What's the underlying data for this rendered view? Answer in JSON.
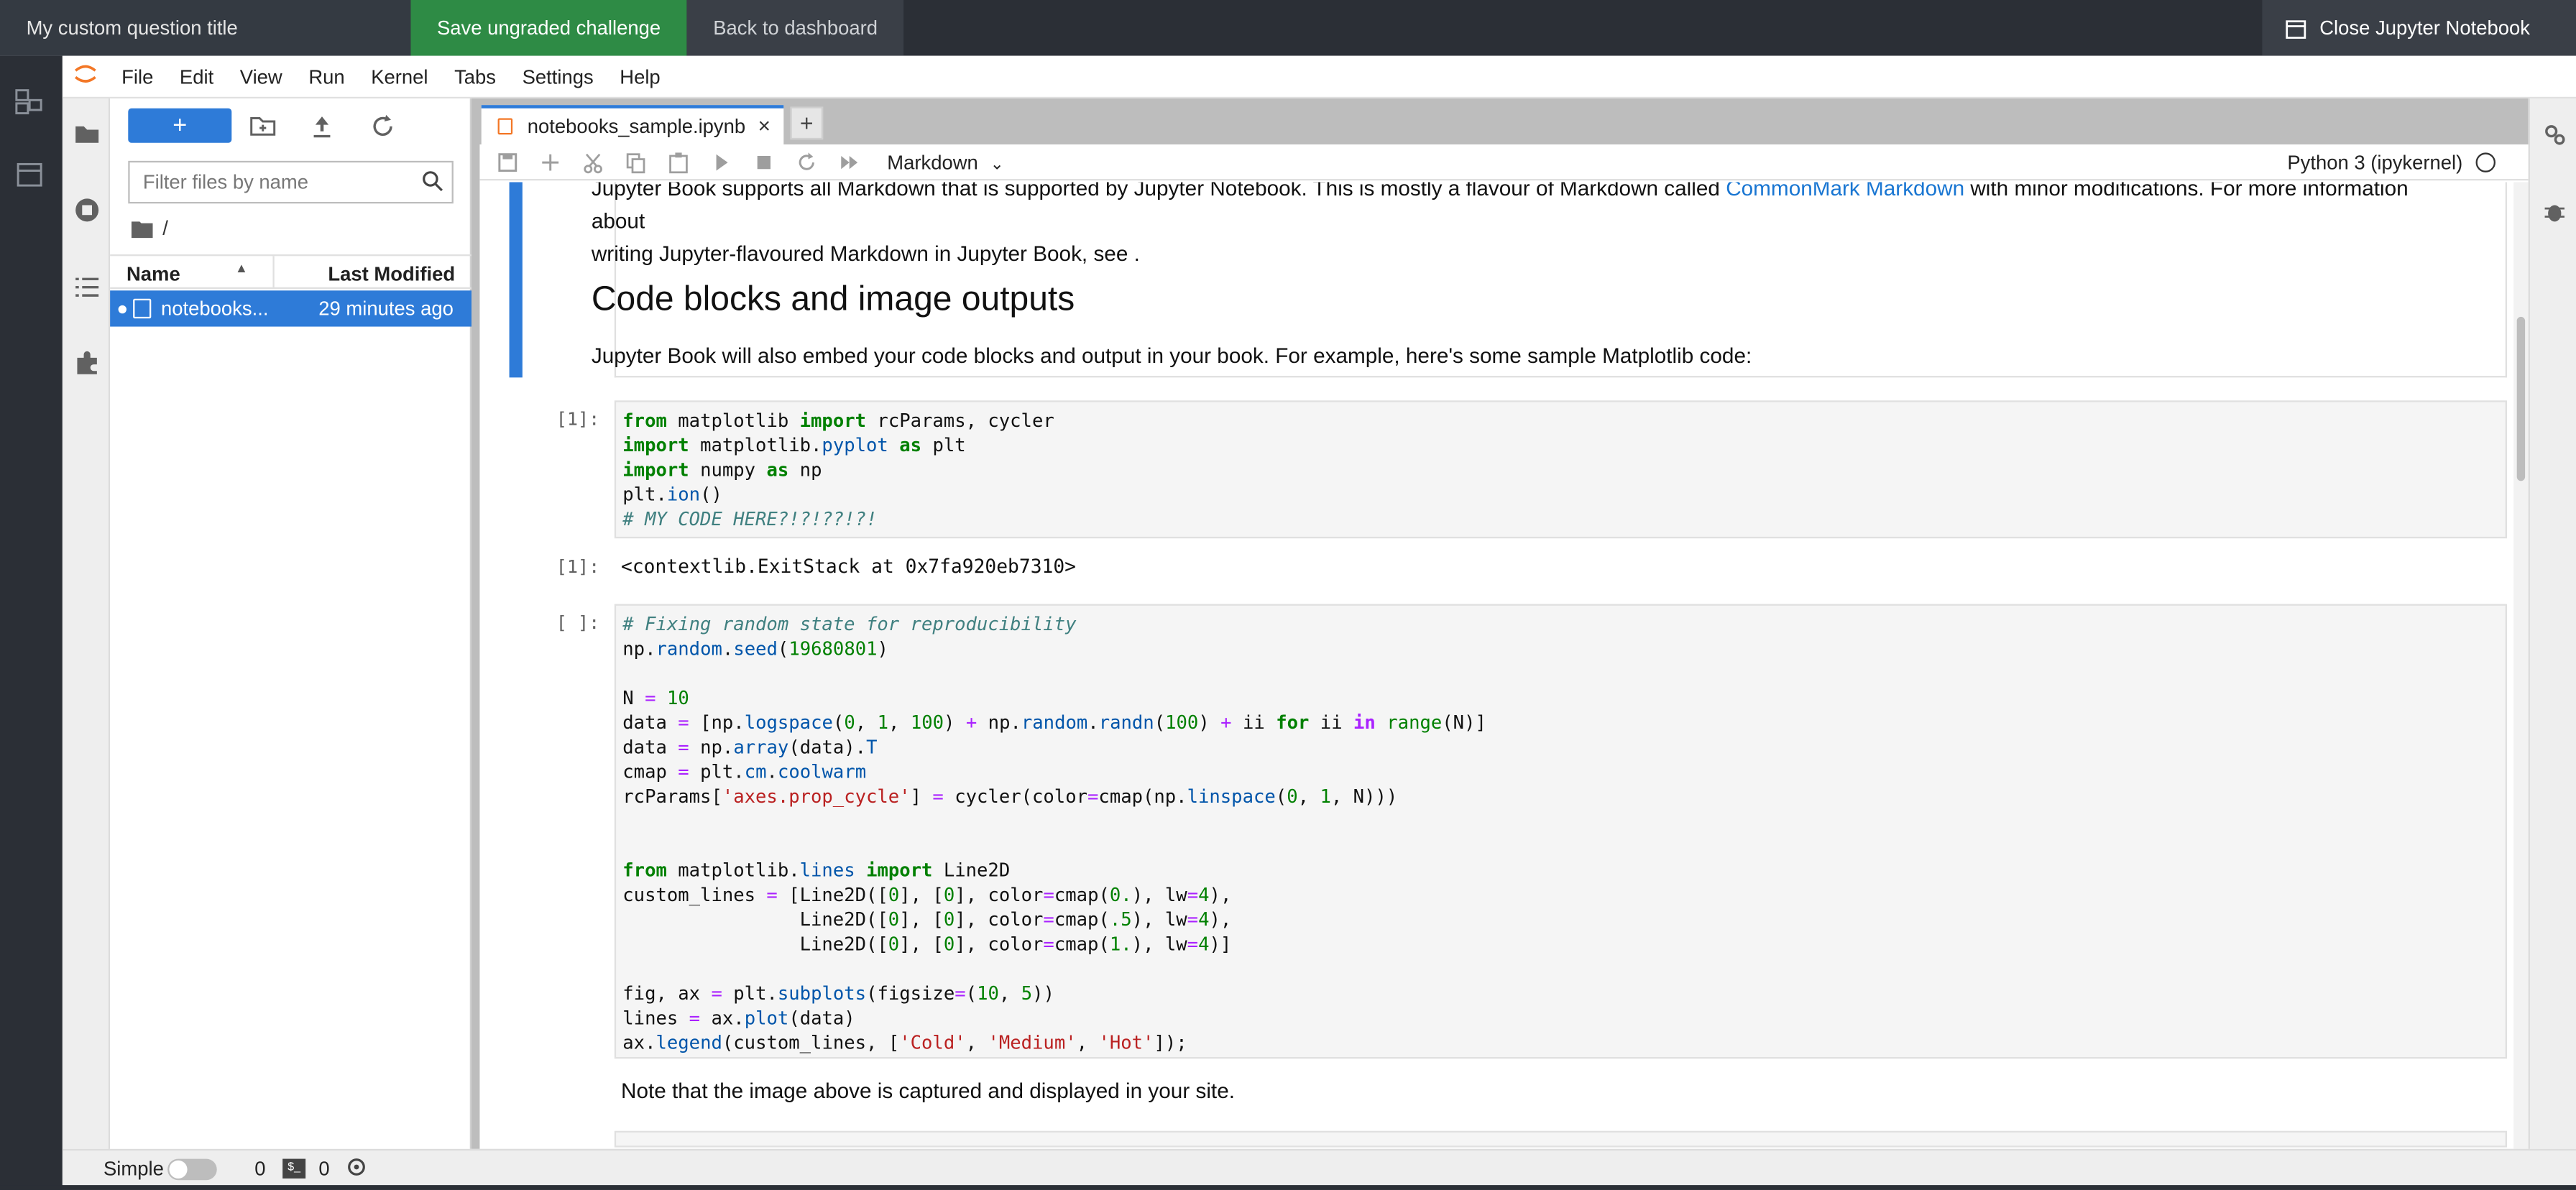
{
  "topbar": {
    "question_title": "My custom question title",
    "save_label": "Save ungraded challenge",
    "back_label": "Back to dashboard",
    "close_label": "Close Jupyter Notebook"
  },
  "menu": [
    "File",
    "Edit",
    "View",
    "Run",
    "Kernel",
    "Tabs",
    "Settings",
    "Help"
  ],
  "filebrowser": {
    "new_label": "+",
    "filter_placeholder": "Filter files by name",
    "breadcrumb": "/",
    "col_name": "Name",
    "col_modified": "Last Modified",
    "files": [
      {
        "name": "notebooks...",
        "modified": "29 minutes ago"
      }
    ]
  },
  "tab": {
    "title": "notebooks_sample.ipynb",
    "close": "×",
    "add": "+"
  },
  "toolbar": {
    "cell_type": "Markdown",
    "kernel": "Python 3 (ipykernel)"
  },
  "notebook": {
    "md_line1_a": "Jupyter Book supports all Markdown that is supported by Jupyter Notebook. This is mostly a flavour of Markdown called ",
    "md_link": "CommonMark Markdown",
    "md_line1_b": " with minor modifications. For more information about",
    "md_line2": "writing Jupyter-flavoured Markdown in Jupyter Book, see .",
    "heading": "Code blocks and image outputs",
    "md_para": "Jupyter Book will also embed your code blocks and output in your book. For example, here's some sample Matplotlib code:",
    "prompt_1_in": "[1]:",
    "prompt_1_out": "[1]:",
    "output_1": "<contextlib.ExitStack at 0x7fa920eb7310>",
    "prompt_2_in": "[ ]:",
    "note": "Note that the image above is captured and displayed in your site."
  },
  "statusbar": {
    "mode": "Simple",
    "count1": "0",
    "count2": "0",
    "term_icon": "$_"
  }
}
